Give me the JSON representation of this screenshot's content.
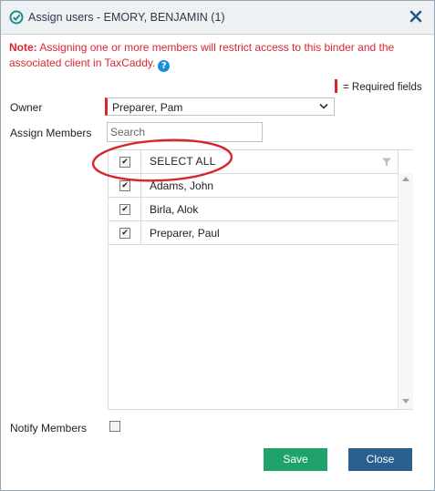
{
  "dialog": {
    "title": "Assign users - EMORY, BENJAMIN (1)",
    "note_label": "Note:",
    "note_text": " Assigning one or more members will restrict access to this binder and the associated client in TaxCaddy.",
    "help_glyph": "?",
    "required_legend": "= Required fields"
  },
  "form": {
    "owner_label": "Owner",
    "owner_value": "Preparer, Pam",
    "assign_label": "Assign Members",
    "search_placeholder": "Search",
    "notify_label": "Notify Members",
    "notify_checked": false
  },
  "members_grid": {
    "header_label": "SELECT ALL",
    "header_checked": true,
    "rows": [
      {
        "name": "Adams, John",
        "checked": true
      },
      {
        "name": "Birla, Alok",
        "checked": true
      },
      {
        "name": "Preparer, Paul",
        "checked": true
      }
    ]
  },
  "buttons": {
    "save_label": "Save",
    "close_label": "Close"
  },
  "colors": {
    "required": "#d9262e",
    "save": "#1fa26b",
    "close": "#2b5f8f",
    "annotation": "#d9262e"
  },
  "icons": {
    "title": "check-circle-icon",
    "close": "close-icon",
    "help": "help-icon",
    "dropdown": "chevron-down-icon",
    "filter": "filter-icon"
  }
}
